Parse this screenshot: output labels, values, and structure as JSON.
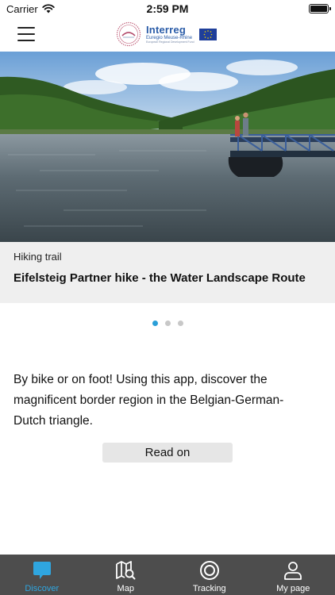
{
  "status_bar": {
    "carrier": "Carrier",
    "time": "2:59 PM",
    "wifi_icon": "wifi-icon",
    "battery_level": 1.0
  },
  "header": {
    "menu_icon": "hamburger-menu-icon",
    "logo": {
      "title": "Interreg",
      "subtitle": "Euregio Meuse-Rhine",
      "fine_print": "European Regional Development Fund"
    }
  },
  "carousel": {
    "slide_type": "Hiking trail",
    "slide_title": "Eifelsteig Partner hike - the Water Landscape Route",
    "page_count": 3,
    "active_index": 0
  },
  "intro": {
    "text": "By bike or on foot! Using this app, discover the magnificent border region in the Belgian-German-Dutch triangle.",
    "read_on_label": "Read on"
  },
  "tabbar": {
    "tabs": [
      {
        "label": "Discover",
        "icon": "speech-bubble-icon",
        "active": true
      },
      {
        "label": "Map",
        "icon": "map-search-icon",
        "active": false
      },
      {
        "label": "Tracking",
        "icon": "target-icon",
        "active": false
      },
      {
        "label": "My page",
        "icon": "user-icon",
        "active": false
      }
    ]
  },
  "colors": {
    "accent": "#2fa6e0",
    "tabbar_bg": "#4d4d4d",
    "caption_bg": "#efefef",
    "logo_blue": "#2a5ca8"
  }
}
